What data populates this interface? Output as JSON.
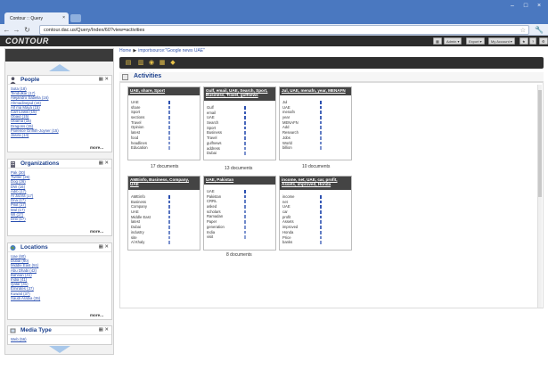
{
  "browser": {
    "tab_title": "Contour :: Query",
    "url": "contour.dac.us/Query/Index/60?view=activities"
  },
  "app": {
    "logo": "CONTOUR",
    "header_buttons": [
      "Admin ▾",
      "Export ▾",
      "My Account ▾",
      "?",
      "⚙"
    ]
  },
  "breadcrumb": {
    "home": "Home",
    "item": "importsource:\"Google news UAE\""
  },
  "sidebar": {
    "widgets": [
      {
        "title": "People",
        "more": "more...",
        "items": [
          "Sota (18)",
          "Tendulkar (17)",
          "Alejandro Sabella (16)",
          "Ahmadinejad (16)",
          "Alf ma Maya (15)",
          "Carl Lewis (15)",
          "Obaid (15)",
          "Obama (15)",
          "Dragons (15)",
          "Florence Griffith-Joyner (15)",
          "Jasira (14)"
        ]
      },
      {
        "title": "Organizations",
        "more": "more...",
        "items": [
          "Pak (30)",
          "Twitter (26)",
          "Dog (26)",
          "DW (16)",
          "Adib (17)",
          "Al Jazira (17)",
          "Dna (17)",
          "Pilot (17)",
          "Mal (17)",
          "WI (17)",
          "Dnb (17)"
        ]
      },
      {
        "title": "Locations",
        "more": "more...",
        "items": [
          "Uae (60)",
          "Dubai (60)",
          "Middle East (51)",
          "Abu Dhabi (42)",
          "Bahrain (41)",
          "India (41)",
          "Qatar (41)",
          "Emirates (37)",
          "Kuwait (37)",
          "Saudi Arabia (35)"
        ]
      },
      {
        "title": "Media Type",
        "more": "",
        "items": [
          "Web (56)"
        ]
      }
    ]
  },
  "main": {
    "section_title": "Activities",
    "cards": [
      {
        "title": "UAE, share, Sport",
        "rows": [
          "UAE",
          "share",
          "Sport",
          "sections",
          "Travel",
          "Opinion",
          "latest",
          "food",
          "headlines",
          "Education"
        ],
        "bars": [
          1.0,
          0.7,
          0.6,
          0.6,
          0.5,
          0.5,
          0.5,
          0.4,
          0.4,
          0.3
        ],
        "docs": "17 documents"
      },
      {
        "title": "Gulf, email, UAE, Search, Sport, Business, Travel, gulfnews",
        "rows": [
          "Gulf",
          "email",
          "UAE",
          "Search",
          "Sport",
          "Business",
          "Travel",
          "gulfnews",
          "address",
          "Dubai"
        ],
        "bars": [
          1.0,
          0.9,
          0.9,
          0.8,
          0.8,
          0.7,
          0.7,
          0.6,
          0.5,
          0.4
        ],
        "docs": "13 documents"
      },
      {
        "title": "Jul, UAE, menafn, year, MENAFN",
        "rows": [
          "Jul",
          "UAE",
          "menafn",
          "year",
          "MENAFN",
          "Add",
          "Research",
          "Jobs",
          "World",
          "billion"
        ],
        "bars": [
          1.0,
          0.9,
          0.8,
          0.8,
          0.7,
          0.6,
          0.6,
          0.5,
          0.5,
          0.4
        ],
        "docs": "10 documents"
      },
      {
        "title": "AMEinfo, Business, Company, UAE",
        "rows": [
          "AMEinfo",
          "Business",
          "Company",
          "UAE",
          "Middle East",
          "latest",
          "Dubai",
          "industry",
          "site",
          "Al Khaly"
        ],
        "bars": [
          1.0,
          0.8,
          0.7,
          0.7,
          0.6,
          0.6,
          0.5,
          0.5,
          0.4,
          0.4
        ],
        "docs": ""
      },
      {
        "title": "UAE, Pakistan",
        "rows": [
          "UAE",
          "Pakistan",
          "CRRL",
          "asked",
          "scholars",
          "Ramadan",
          "Paper",
          "generation",
          "India",
          "visit"
        ],
        "bars": [
          1.0,
          0.8,
          0.6,
          0.6,
          0.5,
          0.5,
          0.5,
          0.4,
          0.4,
          0.3
        ],
        "docs": "8 documents"
      },
      {
        "title": "income, net, UAE, car, profit, Assets, improved, Honda",
        "rows": [
          "income",
          "net",
          "UAE",
          "car",
          "profit",
          "Assets",
          "improved",
          "Honda",
          "Price",
          "banks"
        ],
        "bars": [
          1.0,
          0.9,
          0.9,
          0.8,
          0.8,
          0.7,
          0.7,
          0.6,
          0.5,
          0.4
        ],
        "docs": ""
      }
    ]
  }
}
